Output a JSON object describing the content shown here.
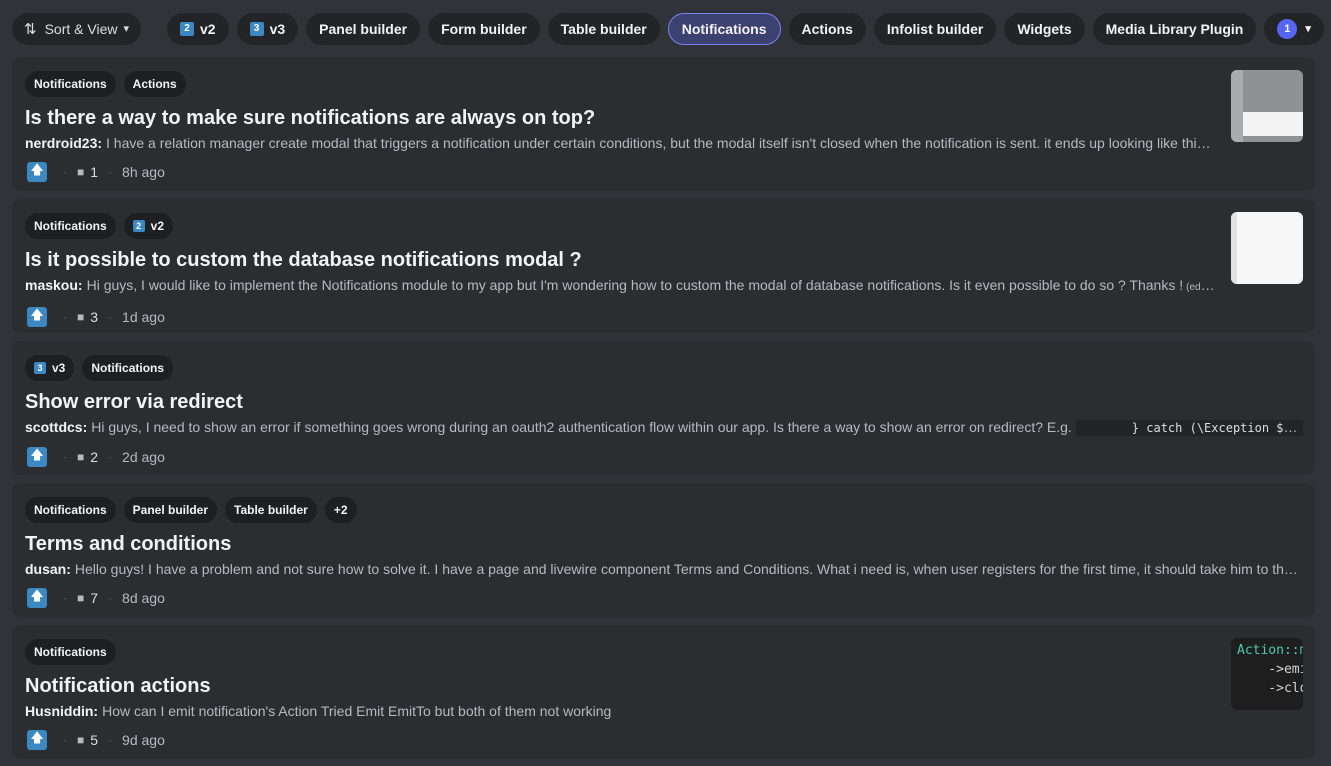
{
  "toolbar": {
    "sort_label": "Sort & View",
    "filters": [
      {
        "label": "v2",
        "num": "2"
      },
      {
        "label": "v3",
        "num": "3"
      },
      {
        "label": "Panel builder"
      },
      {
        "label": "Form builder"
      },
      {
        "label": "Table builder"
      },
      {
        "label": "Notifications",
        "active": true
      },
      {
        "label": "Actions"
      },
      {
        "label": "Infolist builder"
      },
      {
        "label": "Widgets"
      },
      {
        "label": "Media Library Plugin"
      }
    ],
    "more_count": "1"
  },
  "posts": [
    {
      "tags": [
        "Notifications",
        "Actions"
      ],
      "title": "Is there a way to make sure notifications are always on top?",
      "author": "nerdroid23:",
      "preview": "I have a relation manager create modal that triggers a notification under certain conditions, but the modal itself isn't closed when the notification is sent. it ends up looking like this... is t...",
      "comments": "1",
      "time": "8h ago"
    },
    {
      "tags": [
        "Notifications",
        "v2"
      ],
      "title": "Is it possible to custom the database notifications modal ?",
      "author": "maskou:",
      "preview": "Hi guys, I would like to implement the Notifications module to my app but I'm wondering how to custom the modal of database notifications. Is it even possible to do so ? Thanks !",
      "edited": "(edited)",
      "comments": "3",
      "time": "1d ago"
    },
    {
      "tags": [
        "v3",
        "Notifications"
      ],
      "title": "Show error via redirect",
      "author": "scottdcs:",
      "preview": "Hi guys, I need to show an error if something goes wrong during an oauth2 authentication flow within our app. Is there a way to show an error on redirect? E.g.",
      "code": "} catch (\\Exception $e) {",
      "comments": "2",
      "time": "2d ago"
    },
    {
      "tags": [
        "Notifications",
        "Panel builder",
        "Table builder",
        "+2"
      ],
      "title": "Terms and conditions",
      "author": "dusan:",
      "preview": "Hello guys! I have a problem and not sure how to solve it. I have a page and livewire component Terms and Conditions. What i need is, when user registers for the first time, it should take him to the page wh...",
      "comments": "7",
      "time": "8d ago"
    },
    {
      "tags": [
        "Notifications"
      ],
      "title": "Notification actions",
      "author": "Husniddin:",
      "preview": "How can I emit notification's Action Tried Emit EmitTo but both of them not working",
      "comments": "5",
      "time": "9d ago",
      "thumb_code": [
        "Action::m",
        "    ->emi",
        "    ->clo"
      ]
    }
  ],
  "icons": {
    "sort": "sort-arrows-icon",
    "chevron": "chevron-down-icon",
    "upvote": "arrow-up-icon",
    "comment": "speech-bubble-icon"
  },
  "colors": {
    "accent": "#5865f2",
    "upvote": "#3b88c3",
    "card_bg": "#2b2d31",
    "page_bg": "#313338"
  }
}
